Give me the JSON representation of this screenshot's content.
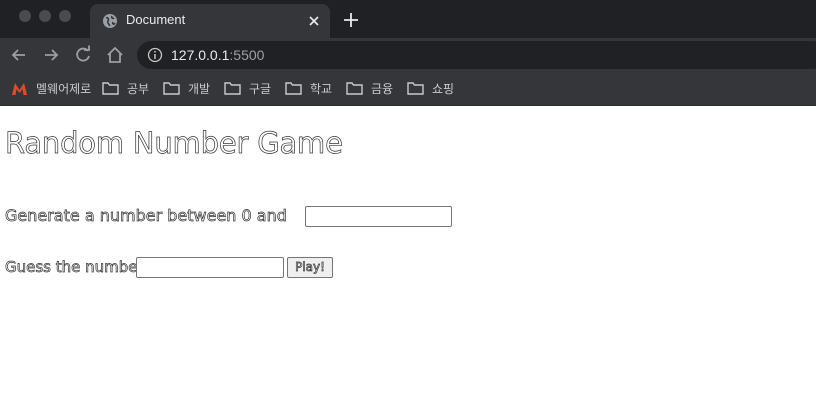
{
  "browser": {
    "tab": {
      "title": "Document"
    },
    "address": {
      "host": "127.0.0.1",
      "port": ":5500"
    },
    "bookmarks": [
      {
        "label": "멜웨어제로",
        "icon": "malwarezero-logo-icon"
      },
      {
        "label": "공부",
        "icon": "folder-icon"
      },
      {
        "label": "개발",
        "icon": "folder-icon"
      },
      {
        "label": "구글",
        "icon": "folder-icon"
      },
      {
        "label": "학교",
        "icon": "folder-icon"
      },
      {
        "label": "금융",
        "icon": "folder-icon"
      },
      {
        "label": "쇼핑",
        "icon": "folder-icon"
      }
    ]
  },
  "page": {
    "title": "Random Number Game",
    "generate_label": "Generate a number between 0 and",
    "generate_value": "",
    "guess_label": "Guess the number:",
    "guess_value": "",
    "play_label": "Play!"
  },
  "colors": {
    "tabstrip": "#202124",
    "toolbar": "#35363a",
    "page_bg": "#ffffff"
  }
}
